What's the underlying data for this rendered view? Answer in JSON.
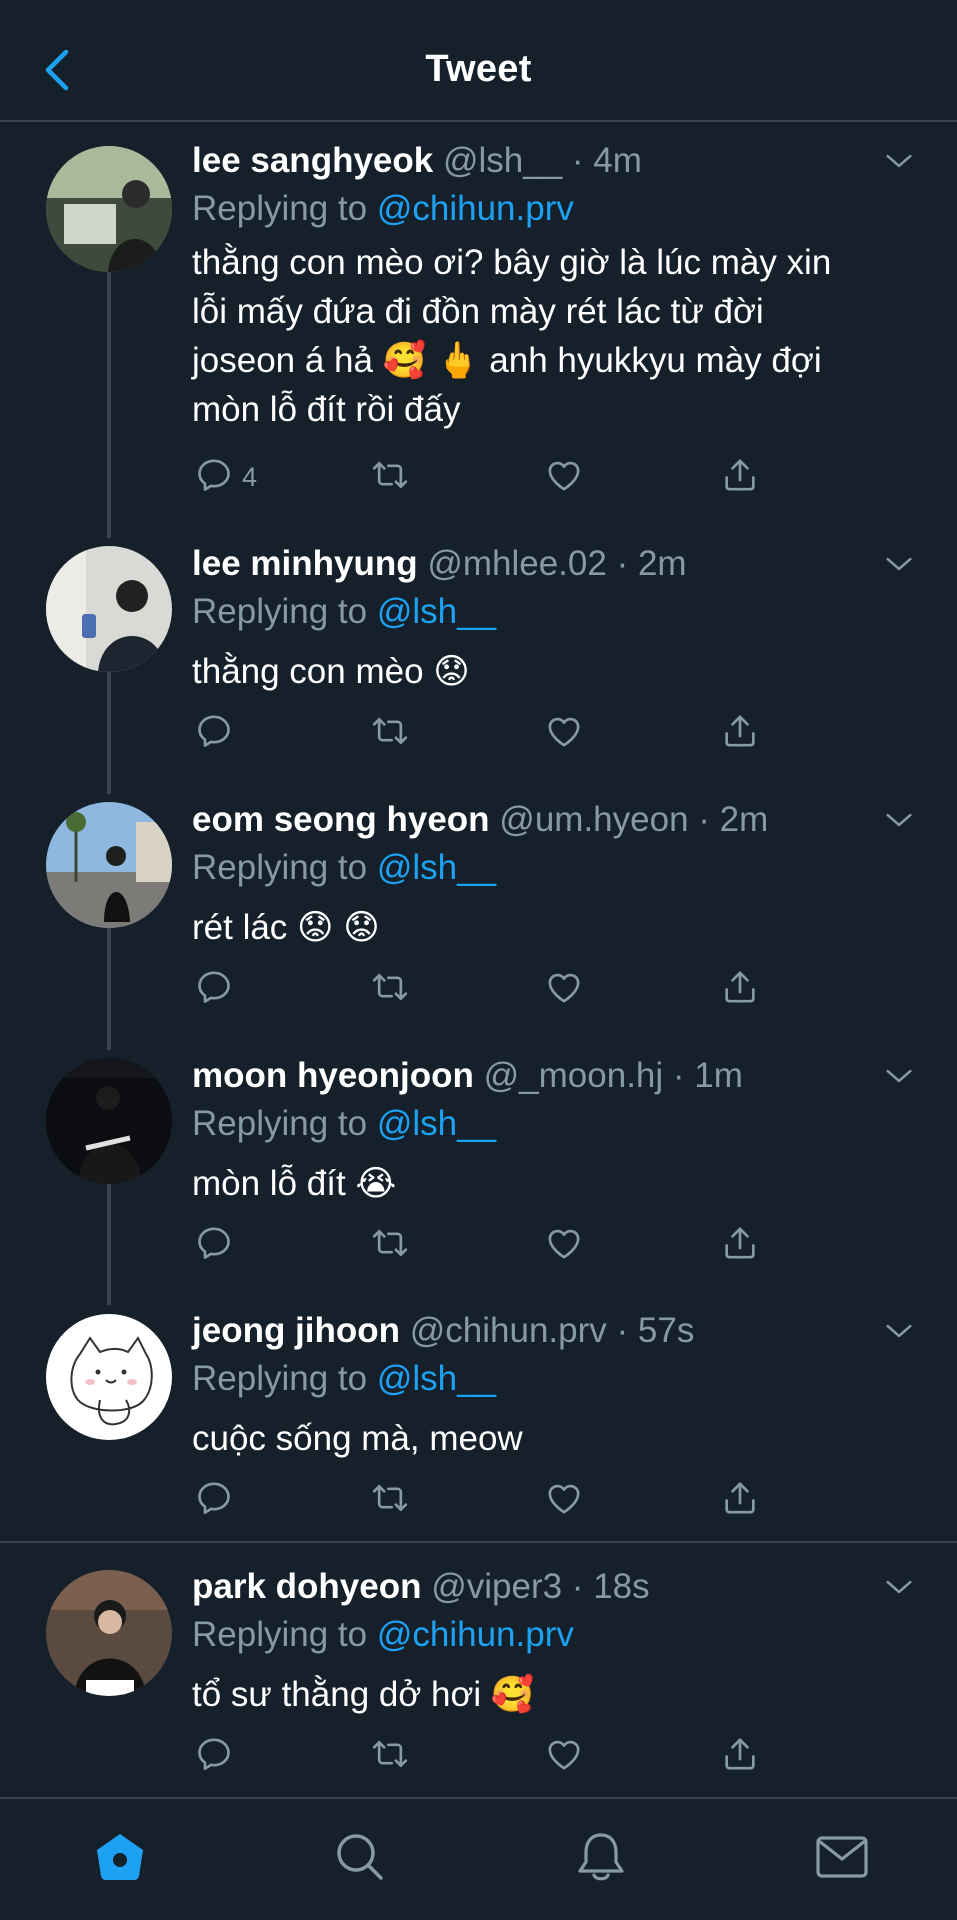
{
  "header": {
    "title": "Tweet",
    "back_icon": "chevron-left-icon"
  },
  "colors": {
    "background": "#15202b",
    "accent": "#1da1f2",
    "muted": "#8899a6",
    "border": "#38444d"
  },
  "tweets": [
    {
      "name": "lee sanghyeok",
      "handle": "@lsh__",
      "time": "4m",
      "replying_label": "Replying to",
      "replying_to": "@chihun.prv",
      "text_lines": [
        "thằng con mèo ơi? bây giờ là lúc mày xin",
        "lỗi mấy đứa đi đồn mày rét lác từ đời",
        "joseon á hả 🥰 🖕 anh hyukkyu mày đợi",
        "mòn lỗ đít rồi đấy"
      ],
      "reply_count": "4"
    },
    {
      "name": "lee minhyung",
      "handle": "@mhlee.02",
      "time": "2m",
      "replying_label": "Replying to",
      "replying_to": "@lsh__",
      "text_lines": [
        "thằng con mèo 😟"
      ],
      "reply_count": ""
    },
    {
      "name": "eom seong hyeon",
      "handle": "@um.hyeon",
      "time": "2m",
      "replying_label": "Replying to",
      "replying_to": "@lsh__",
      "text_lines": [
        "rét lác 😟 😟"
      ],
      "reply_count": ""
    },
    {
      "name": "moon hyeonjoon",
      "handle": "@_moon.hj",
      "time": "1m",
      "replying_label": "Replying to",
      "replying_to": "@lsh__",
      "text_lines": [
        "mòn lỗ đít 😭"
      ],
      "reply_count": ""
    },
    {
      "name": "jeong jihoon",
      "handle": "@chihun.prv",
      "time": "57s",
      "replying_label": "Replying to",
      "replying_to": "@lsh__",
      "text_lines": [
        "cuộc sống mà, meow"
      ],
      "reply_count": ""
    },
    {
      "name": "park dohyeon",
      "handle": "@viper3",
      "time": "18s",
      "replying_label": "Replying to",
      "replying_to": "@chihun.prv",
      "text_lines": [
        "tổ sư thằng dở hơi 🥰"
      ],
      "reply_count": ""
    }
  ],
  "icons": {
    "reply": "reply-icon",
    "retweet": "retweet-icon",
    "like": "heart-icon",
    "share": "share-icon",
    "more": "chevron-down-icon"
  },
  "bottom_nav": [
    {
      "name": "home",
      "icon": "home-icon",
      "active": true
    },
    {
      "name": "search",
      "icon": "search-icon",
      "active": false
    },
    {
      "name": "notifications",
      "icon": "bell-icon",
      "active": false
    },
    {
      "name": "messages",
      "icon": "mail-icon",
      "active": false
    }
  ]
}
